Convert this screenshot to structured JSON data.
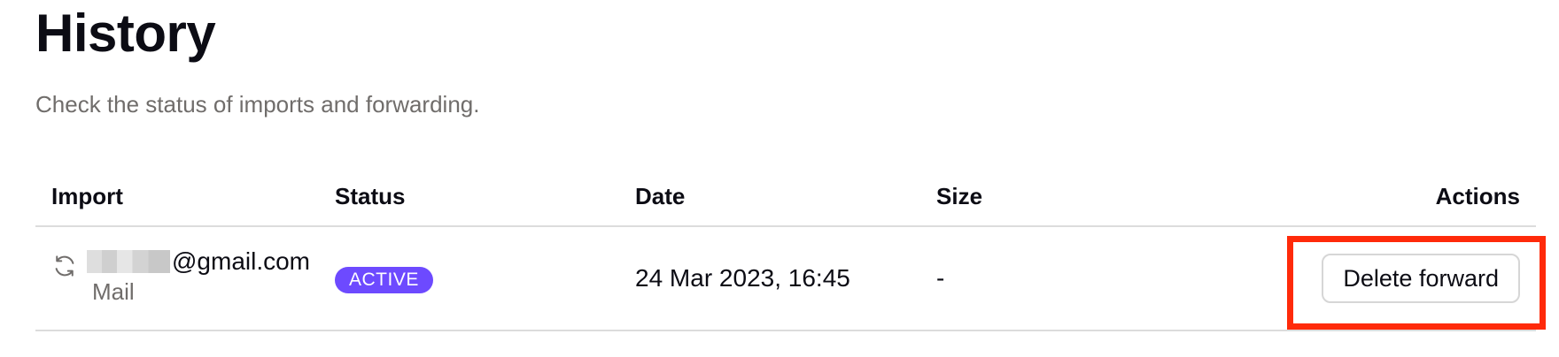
{
  "header": {
    "title": "History",
    "subtitle": "Check the status of imports and forwarding."
  },
  "table": {
    "columns": {
      "import": "Import",
      "status": "Status",
      "date": "Date",
      "size": "Size",
      "actions": "Actions"
    },
    "rows": [
      {
        "address_visible": "@gmail.com",
        "type": "Mail",
        "status": "ACTIVE",
        "date": "24 Mar 2023, 16:45",
        "size": "-",
        "action_label": "Delete forward",
        "icon": "sync-icon"
      }
    ]
  },
  "colors": {
    "accent": "#6d4aff",
    "highlight": "#ff2a0a",
    "muted_text": "#706d6b"
  }
}
